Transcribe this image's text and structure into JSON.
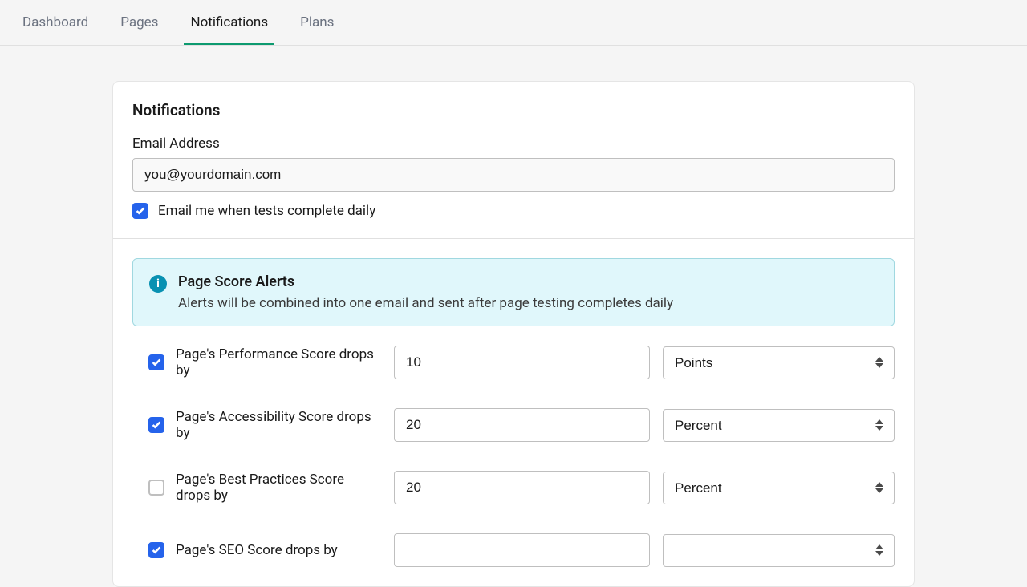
{
  "tabs": {
    "items": [
      {
        "label": "Dashboard",
        "active": false
      },
      {
        "label": "Pages",
        "active": false
      },
      {
        "label": "Notifications",
        "active": true
      },
      {
        "label": "Plans",
        "active": false
      }
    ]
  },
  "notifications": {
    "title": "Notifications",
    "email_label": "Email Address",
    "email_value": "you@yourdomain.com",
    "daily_checkbox_label": "Email me when tests complete daily",
    "daily_checkbox_checked": true
  },
  "callout": {
    "title": "Page Score Alerts",
    "description": "Alerts will be combined into one email and sent after page testing completes daily"
  },
  "alerts": [
    {
      "checked": true,
      "label": "Page's Performance Score drops by",
      "value": "10",
      "unit": "Points"
    },
    {
      "checked": true,
      "label": "Page's Accessibility Score drops by",
      "value": "20",
      "unit": "Percent"
    },
    {
      "checked": false,
      "label": "Page's Best Practices Score drops by",
      "value": "20",
      "unit": "Percent"
    },
    {
      "checked": true,
      "label": "Page's SEO Score drops by",
      "value": "",
      "unit": ""
    }
  ]
}
